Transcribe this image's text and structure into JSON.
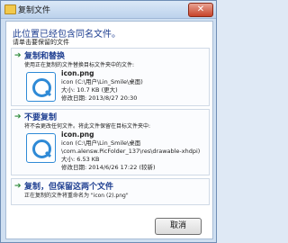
{
  "window": {
    "title": "复制文件"
  },
  "heading": "此位置已经包含同名文件。",
  "subheading": "请单击要保留的文件",
  "options": [
    {
      "title": "复制和替换",
      "desc": "使用正在复制的文件替换目标文件夹中的文件:",
      "file": {
        "name": "icon.png",
        "path": "icon (C:\\用户\\Lin_Smile\\桌面)",
        "size": "大小: 10.7 KB (更大)",
        "modified": "修改日期: 2013/8/27 20:30"
      }
    },
    {
      "title": "不要复制",
      "desc": "将不会更改任何文件。将此文件保留在目标文件夹中:",
      "file": {
        "name": "icon.png",
        "path": "icon (C:\\用户\\Lin_Smile\\桌面",
        "path2": "\\com.alensw.PicFolder_137\\res\\drawable-xhdpi)",
        "size": "大小: 6.53 KB",
        "modified": "修改日期: 2014/6/26 17:22 (较新)"
      }
    },
    {
      "title": "复制，但保留这两个文件",
      "desc": "正在复制的文件将重命名为 \"icon (2).png\""
    }
  ],
  "cancel_label": "取消",
  "colors": {
    "heading": "#1f3f91",
    "arrow": "#2e8b3a"
  }
}
